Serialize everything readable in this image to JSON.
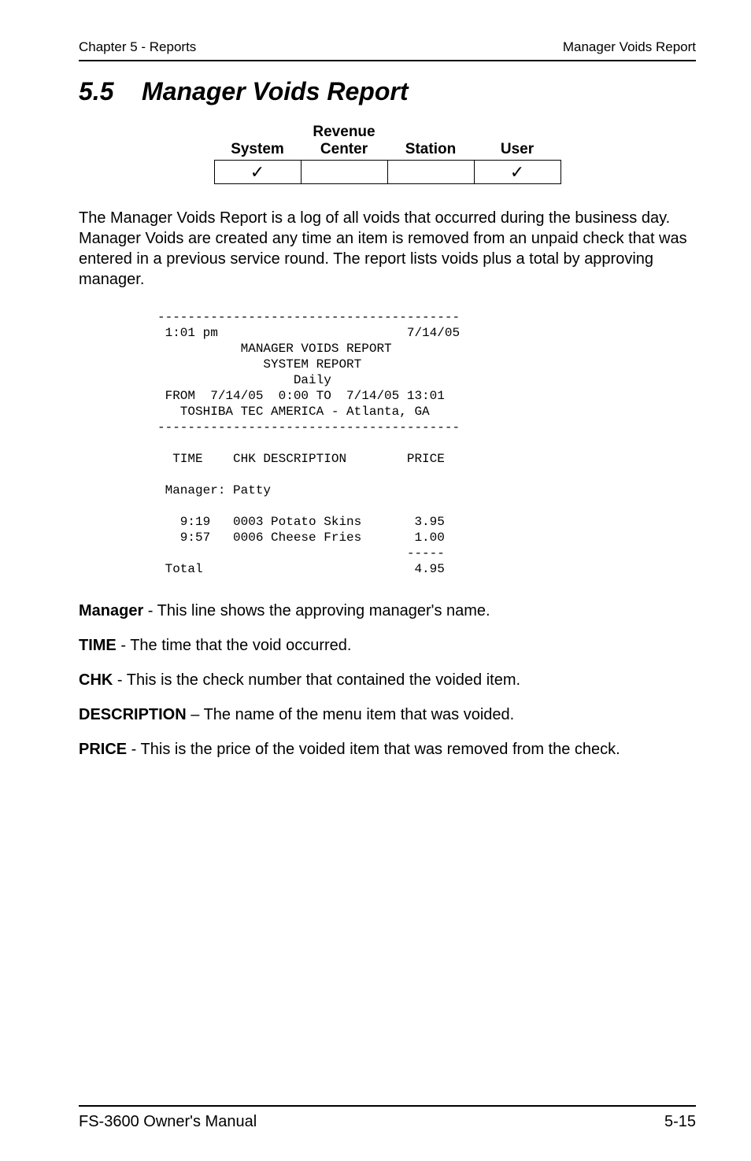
{
  "header": {
    "left": "Chapter 5 - Reports",
    "right": "Manager Voids Report"
  },
  "section": {
    "number": "5.5",
    "title": "Manager Voids Report"
  },
  "availability": {
    "colRevenueTop": "Revenue",
    "cols": {
      "system": "System",
      "center": "Center",
      "station": "Station",
      "user": "User"
    },
    "values": {
      "system": "✓",
      "center": "",
      "station": "",
      "user": "✓"
    }
  },
  "intro": "The Manager Voids Report is a log of all voids that occurred during the business day.  Manager Voids are created any time an item is removed from an unpaid check that was entered in a previous service round.  The report lists voids plus a total by approving manager.",
  "report": "----------------------------------------\n 1:01 pm                         7/14/05\n           MANAGER VOIDS REPORT\n              SYSTEM REPORT\n                  Daily\n FROM  7/14/05  0:00 TO  7/14/05 13:01\n   TOSHIBA TEC AMERICA - Atlanta, GA\n----------------------------------------\n\n  TIME    CHK DESCRIPTION        PRICE\n\n Manager: Patty\n\n   9:19   0003 Potato Skins       3.95\n   9:57   0006 Cheese Fries       1.00\n                                 -----\n Total                            4.95",
  "defs": {
    "manager_label": "Manager",
    "manager_text": " - This line shows the approving manager's name.",
    "time_label": "TIME",
    "time_text": " - The time that the void occurred.",
    "chk_label": "CHK",
    "chk_text": " - This is the check number that contained the voided item.",
    "desc_label": "DESCRIPTION",
    "desc_text": " – The name of the menu item that was voided.",
    "price_label": "PRICE",
    "price_text": " - This is the price of the voided item that was removed from the check."
  },
  "footer": {
    "left": "FS-3600 Owner's Manual",
    "right": "5-15"
  }
}
